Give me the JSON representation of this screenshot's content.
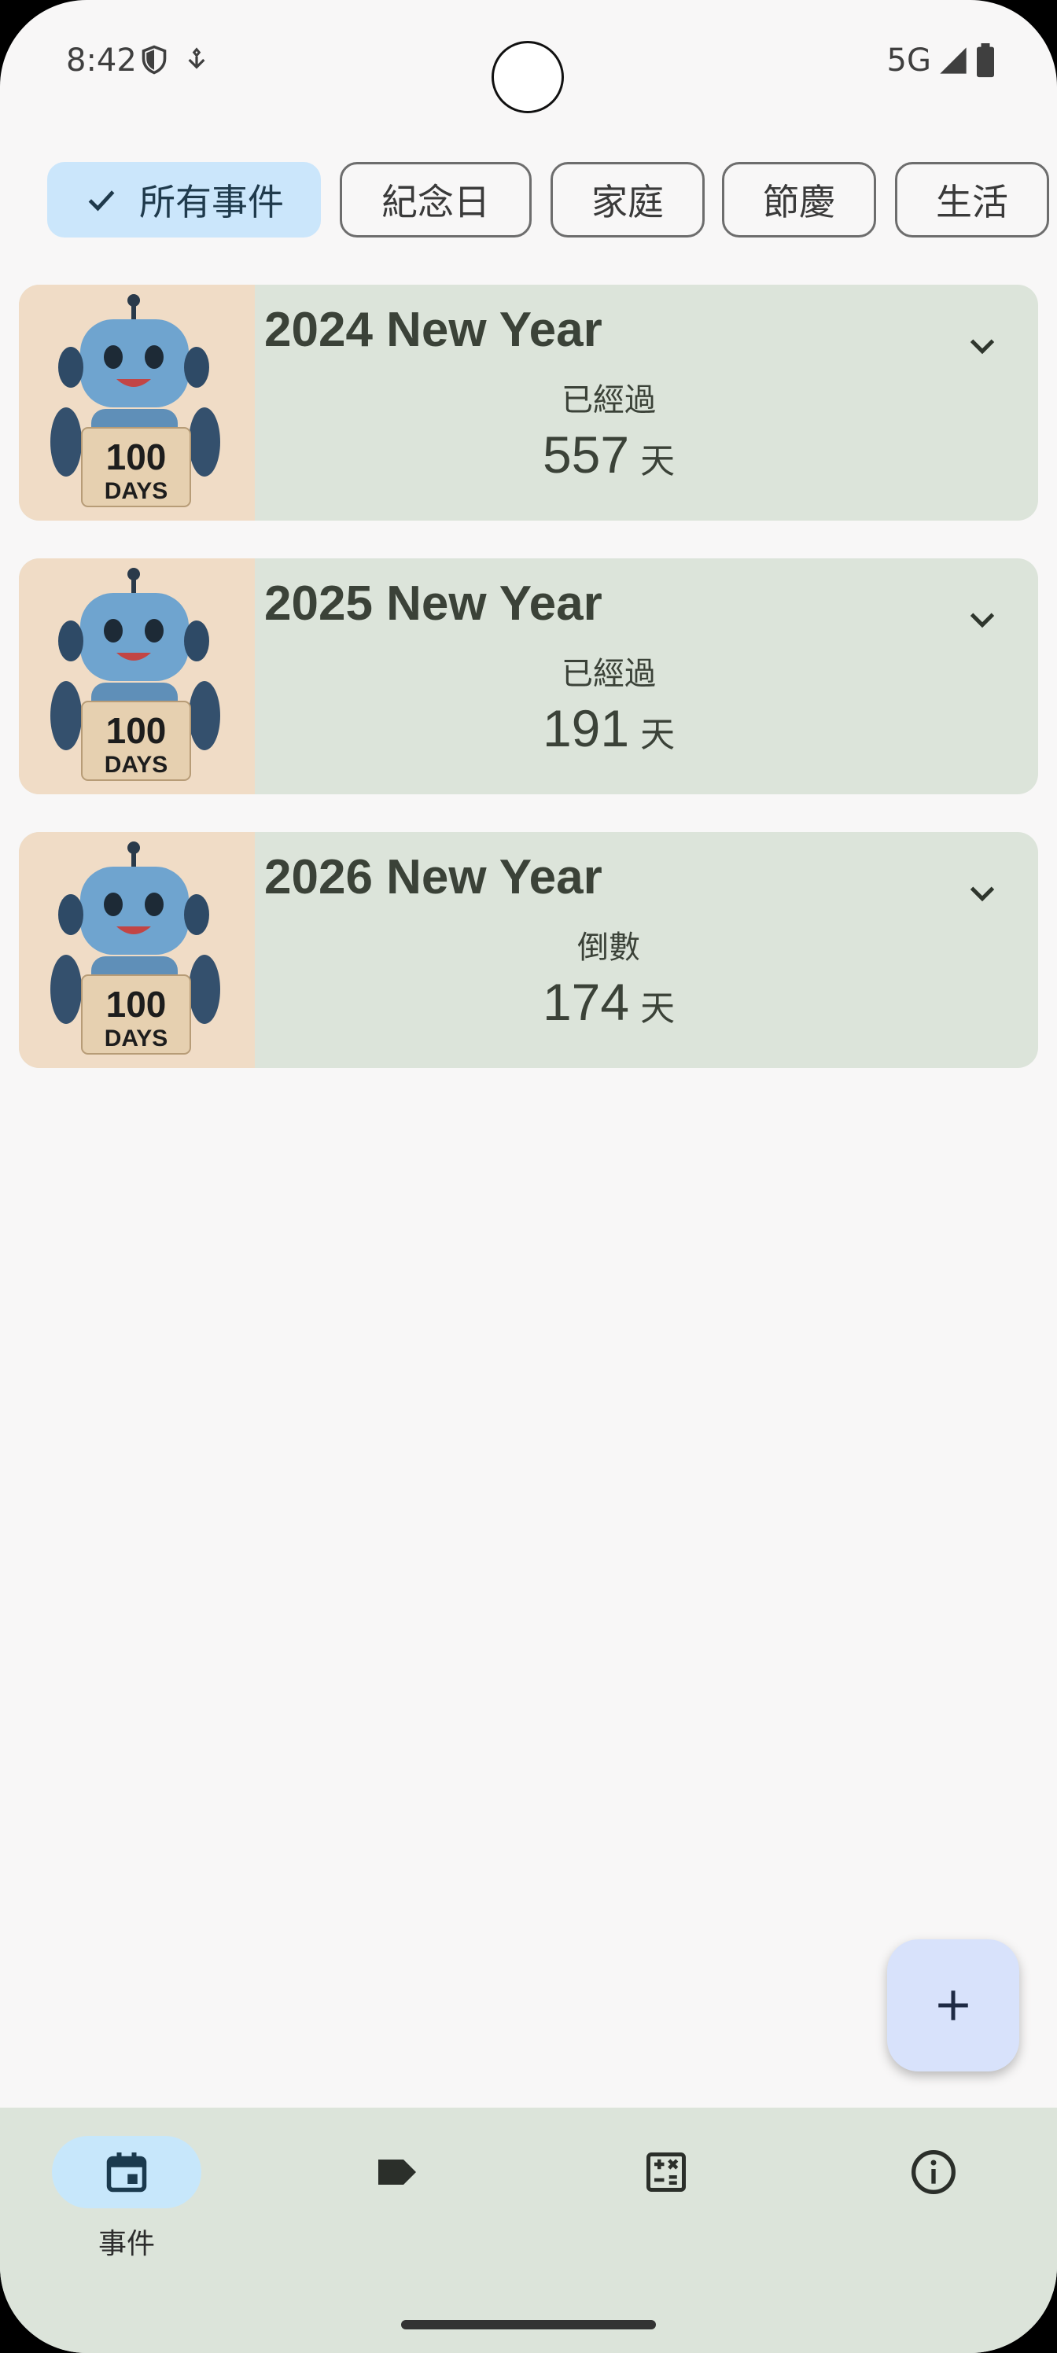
{
  "status_bar": {
    "time": "8:42",
    "network": "5G",
    "icons": [
      "shield-icon",
      "location-icon",
      "signal-icon",
      "battery-icon"
    ]
  },
  "filters": {
    "chips": [
      {
        "label": "所有事件",
        "selected": true
      },
      {
        "label": "紀念日",
        "selected": false
      },
      {
        "label": "家庭",
        "selected": false
      },
      {
        "label": "節慶",
        "selected": false
      },
      {
        "label": "生活",
        "selected": false
      }
    ]
  },
  "events": [
    {
      "title": "2024 New Year",
      "status": "已經過",
      "count": "557",
      "unit": "天",
      "thumb_text_top": "100",
      "thumb_text_bottom": "DAYS"
    },
    {
      "title": "2025 New Year",
      "status": "已經過",
      "count": "191",
      "unit": "天",
      "thumb_text_top": "100",
      "thumb_text_bottom": "DAYS"
    },
    {
      "title": "2026 New Year",
      "status": "倒數",
      "count": "174",
      "unit": "天",
      "thumb_text_top": "100",
      "thumb_text_bottom": "DAYS"
    }
  ],
  "fab": {
    "icon": "plus-icon"
  },
  "bottom_nav": {
    "items": [
      {
        "label": "事件",
        "icon": "calendar-icon",
        "active": true
      },
      {
        "label": "",
        "icon": "label-icon",
        "active": false
      },
      {
        "label": "",
        "icon": "calculator-icon",
        "active": false
      },
      {
        "label": "",
        "icon": "info-icon",
        "active": false
      }
    ]
  },
  "colors": {
    "background": "#f8f7f7",
    "card": "#dce4da",
    "chip_selected": "#cbe6fb",
    "fab": "#d8e2fb",
    "nav_active": "#c7e7fb"
  }
}
